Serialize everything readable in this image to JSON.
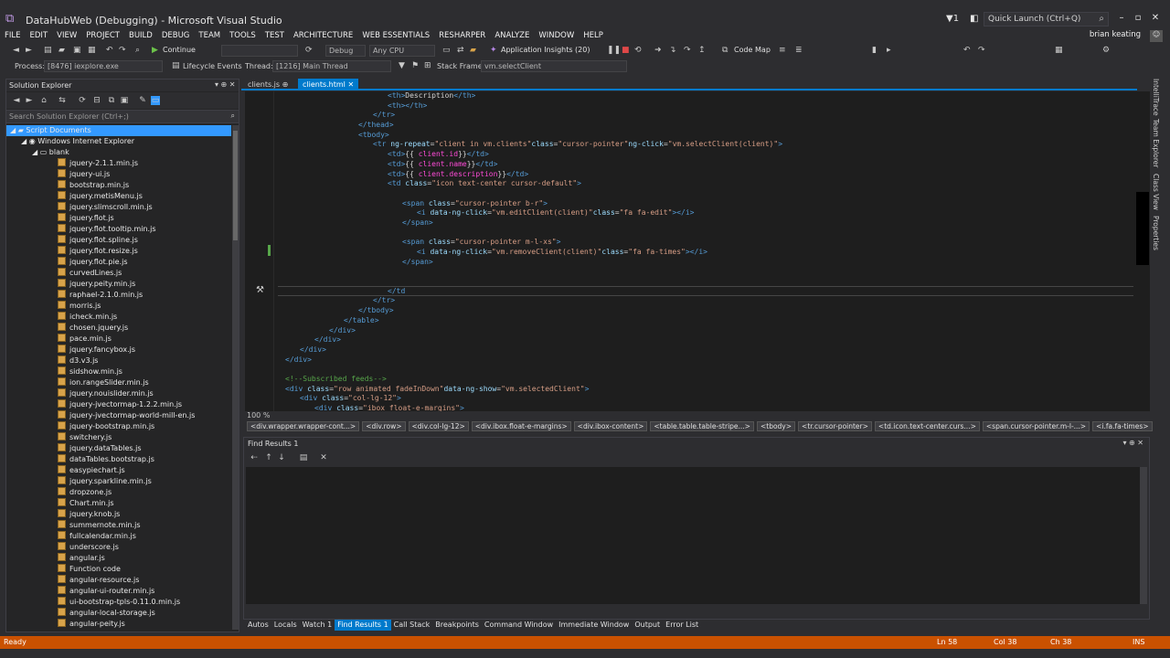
{
  "window": {
    "title": "DataHubWeb (Debugging) - Microsoft Visual Studio",
    "quick_launch": "Quick Launch (Ctrl+Q)",
    "user": "brian keating"
  },
  "menu": [
    "FILE",
    "EDIT",
    "VIEW",
    "PROJECT",
    "BUILD",
    "DEBUG",
    "TEAM",
    "TOOLS",
    "TEST",
    "ARCHITECTURE",
    "WEB ESSENTIALS",
    "RESHARPER",
    "ANALYZE",
    "WINDOW",
    "HELP"
  ],
  "toolbar": {
    "continue": "Continue",
    "config": "Debug",
    "platform": "Any CPU",
    "insights": "Application Insights (20)",
    "codemap": "Code Map",
    "process_label": "Process:",
    "process": "[8476] iexplore.exe",
    "lifecycle": "Lifecycle Events",
    "thread_label": "Thread:",
    "thread": "[1216] Main Thread",
    "stack_label": "Stack Frame:",
    "stack": "vm.selectClient"
  },
  "solution_explorer": {
    "title": "Solution Explorer",
    "search_placeholder": "Search Solution Explorer (Ctrl+;)",
    "root": "Script Documents",
    "node": "Windows Internet Explorer",
    "blank": "blank",
    "files": [
      "jquery-2.1.1.min.js",
      "jquery-ui.js",
      "bootstrap.min.js",
      "jquery.metisMenu.js",
      "jquery.slimscroll.min.js",
      "jquery.flot.js",
      "jquery.flot.tooltip.min.js",
      "jquery.flot.spline.js",
      "jquery.flot.resize.js",
      "jquery.flot.pie.js",
      "curvedLines.js",
      "jquery.peity.min.js",
      "raphael-2.1.0.min.js",
      "morris.js",
      "icheck.min.js",
      "chosen.jquery.js",
      "pace.min.js",
      "jquery.fancybox.js",
      "d3.v3.js",
      "sidshow.min.js",
      "ion.rangeSlider.min.js",
      "jquery.nouislider.min.js",
      "jquery-jvectormap-1.2.2.min.js",
      "jquery-jvectormap-world-mill-en.js",
      "jquery-bootstrap.min.js",
      "switchery.js",
      "jquery.dataTables.js",
      "dataTables.bootstrap.js",
      "easypiechart.js",
      "jquery.sparkline.min.js",
      "dropzone.js",
      "Chart.min.js",
      "jquery.knob.js",
      "summernote.min.js",
      "fullcalendar.min.js",
      "underscore.js",
      "angular.js",
      "Function code",
      "angular-resource.js",
      "angular-ui-router.min.js",
      "ui-bootstrap-tpls-0.11.0.min.js",
      "angular-local-storage.js",
      "angular-peity.js"
    ]
  },
  "editor": {
    "tabs": [
      "clients.js",
      "clients.html"
    ],
    "zoom": "100 %",
    "lines": [
      [
        [
          "t",
          "        <th>"
        ],
        [
          "w",
          "Description"
        ],
        [
          "t",
          "</th>"
        ]
      ],
      [
        [
          "t",
          "        <th></th>"
        ]
      ],
      [
        [
          "t",
          "    </tr>"
        ]
      ],
      [
        [
          "t",
          "  </thead>"
        ]
      ],
      [
        [
          "t",
          "  <tbody>"
        ]
      ],
      [
        [
          "t",
          "    <tr "
        ],
        [
          "a",
          "ng-repeat"
        ],
        [
          "w",
          "="
        ],
        [
          "s",
          "\"client in vm.clients\""
        ],
        [
          "a",
          " class"
        ],
        [
          "w",
          "="
        ],
        [
          "s",
          "\"cursor-pointer\""
        ],
        [
          "a",
          " ng-click"
        ],
        [
          "w",
          "="
        ],
        [
          "s",
          "\"vm.selectClient(client)\""
        ],
        [
          "t",
          ">"
        ]
      ],
      [
        [
          "t",
          "        <td>"
        ],
        [
          "w",
          "{{ "
        ],
        [
          "m",
          "client.id"
        ],
        [
          "w",
          " }}"
        ],
        [
          "t",
          "</td>"
        ]
      ],
      [
        [
          "t",
          "        <td>"
        ],
        [
          "w",
          "{{ "
        ],
        [
          "m",
          "client.name"
        ],
        [
          "w",
          " }}"
        ],
        [
          "t",
          "</td>"
        ]
      ],
      [
        [
          "t",
          "        <td>"
        ],
        [
          "w",
          "{{ "
        ],
        [
          "m",
          "client.description"
        ],
        [
          "w",
          " }}"
        ],
        [
          "t",
          "</td>"
        ]
      ],
      [
        [
          "t",
          "        <td "
        ],
        [
          "a",
          "class"
        ],
        [
          "w",
          "="
        ],
        [
          "s",
          "\"icon text-center cursor-default\""
        ],
        [
          "t",
          ">"
        ]
      ],
      [
        [
          "w",
          ""
        ]
      ],
      [
        [
          "t",
          "            <span "
        ],
        [
          "a",
          "class"
        ],
        [
          "w",
          "="
        ],
        [
          "s",
          "\"cursor-pointer b-r\""
        ],
        [
          "t",
          ">"
        ]
      ],
      [
        [
          "t",
          "                <i "
        ],
        [
          "a",
          "data-ng-click"
        ],
        [
          "w",
          "="
        ],
        [
          "s",
          "\"vm.editClient(client)\""
        ],
        [
          "a",
          " class"
        ],
        [
          "w",
          "="
        ],
        [
          "s",
          "\"fa fa-edit\""
        ],
        [
          "t",
          "></i>"
        ]
      ],
      [
        [
          "t",
          "            </span>"
        ]
      ],
      [
        [
          "w",
          ""
        ]
      ],
      [
        [
          "t",
          "            <span "
        ],
        [
          "a",
          "class"
        ],
        [
          "w",
          "="
        ],
        [
          "s",
          "\"cursor-pointer m-l-xs\""
        ],
        [
          "t",
          ">"
        ]
      ],
      [
        [
          "t",
          "                <i "
        ],
        [
          "a",
          "data-ng-click"
        ],
        [
          "w",
          "="
        ],
        [
          "s",
          "\"vm.removeClient(client)\""
        ],
        [
          "a",
          " class"
        ],
        [
          "w",
          "="
        ],
        [
          "s",
          "\"fa fa-times\""
        ],
        [
          "t",
          "></i>"
        ]
      ],
      [
        [
          "t",
          "            </span>"
        ]
      ],
      [
        [
          "w",
          ""
        ]
      ],
      [
        [
          "w",
          ""
        ]
      ],
      [
        [
          "t",
          "        </td"
        ]
      ],
      [
        [
          "t",
          "    </tr>"
        ]
      ],
      [
        [
          "t",
          "  </tbody>"
        ]
      ],
      [
        [
          "t",
          "</table>"
        ]
      ],
      [
        [
          "t",
          "</div>"
        ]
      ],
      [
        [
          "t",
          "</div>"
        ]
      ],
      [
        [
          "t",
          "</div>"
        ]
      ],
      [
        [
          "t",
          "</div>"
        ]
      ],
      [
        [
          "w",
          ""
        ]
      ],
      [
        [
          "c",
          "<!--Subscribed feeds-->"
        ]
      ],
      [
        [
          "t",
          "<div "
        ],
        [
          "a",
          "class"
        ],
        [
          "w",
          "="
        ],
        [
          "s",
          "\"row animated fadeInDown\""
        ],
        [
          "a",
          " data-ng-show"
        ],
        [
          "w",
          "="
        ],
        [
          "s",
          "\"vm.selectedClient\""
        ],
        [
          "t",
          ">"
        ]
      ],
      [
        [
          "t",
          "    <div "
        ],
        [
          "a",
          "class"
        ],
        [
          "w",
          "="
        ],
        [
          "s",
          "\"col-lg-12\""
        ],
        [
          "t",
          ">"
        ]
      ],
      [
        [
          "t",
          "        <div "
        ],
        [
          "a",
          "class"
        ],
        [
          "w",
          "="
        ],
        [
          "s",
          "\"ibox float-e-margins\""
        ],
        [
          "t",
          ">"
        ]
      ]
    ],
    "indent": [
      15,
      15,
      13,
      11,
      11,
      13,
      15,
      15,
      15,
      15,
      15,
      17,
      19,
      17,
      15,
      17,
      19,
      17,
      15,
      15,
      15,
      13,
      11,
      9,
      7,
      5,
      3,
      1,
      1,
      1,
      1,
      3,
      5
    ],
    "breadcrumbs": [
      "<div.wrapper.wrapper-cont...>",
      "<div.row>",
      "<div.col-lg-12>",
      "<div.ibox.float-e-margins>",
      "<div.ibox-content>",
      "<table.table.table-stripe...>",
      "<tbody>",
      "<tr.cursor-pointer>",
      "<td.icon.text-center.curs...>",
      "<span.cursor-pointer.m-l-...>",
      "<i.fa.fa-times>"
    ]
  },
  "side_rail": [
    "IntelliTrace",
    "Team Explorer",
    "Class View",
    "Properties"
  ],
  "find_results": {
    "title": "Find Results 1"
  },
  "bottom_tabs": [
    "Autos",
    "Locals",
    "Watch 1",
    "Find Results 1",
    "Call Stack",
    "Breakpoints",
    "Command Window",
    "Immediate Window",
    "Output",
    "Error List"
  ],
  "status": {
    "left": "Ready",
    "ln": "Ln 58",
    "col": "Col 38",
    "ch": "Ch 38",
    "ins": "INS"
  }
}
